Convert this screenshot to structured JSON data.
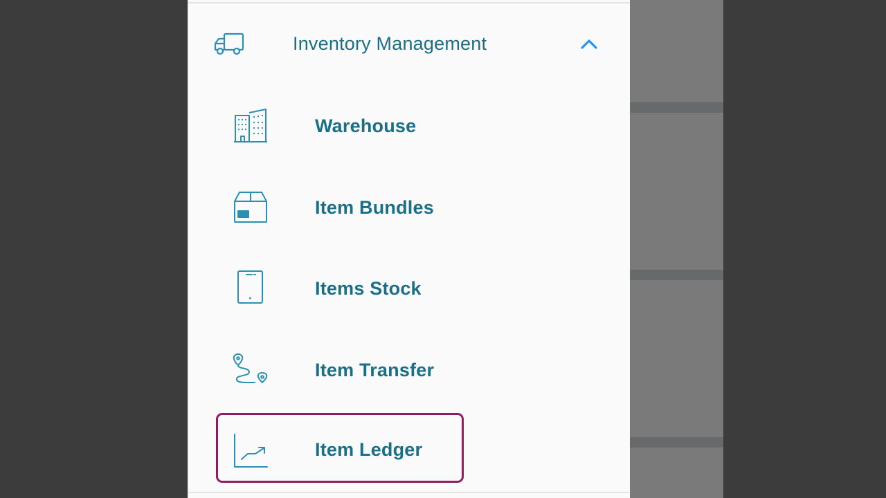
{
  "drawer": {
    "group": {
      "label": "Inventory Management",
      "icon": "truck-icon",
      "expanded": true
    },
    "items": [
      {
        "label": "Warehouse",
        "icon": "buildings-icon"
      },
      {
        "label": "Item Bundles",
        "icon": "box-icon"
      },
      {
        "label": "Items Stock",
        "icon": "tablet-icon"
      },
      {
        "label": "Item Transfer",
        "icon": "route-icon"
      },
      {
        "label": "Item Ledger",
        "icon": "trend-chart-icon",
        "highlighted": true
      }
    ]
  },
  "colors": {
    "text": "#1a6f86",
    "icon": "#2b8fb0",
    "chevron": "#2196f3",
    "highlight": "#8e1f5e",
    "drawer_bg": "#fafafa",
    "backdrop": "#7a7a7a"
  }
}
